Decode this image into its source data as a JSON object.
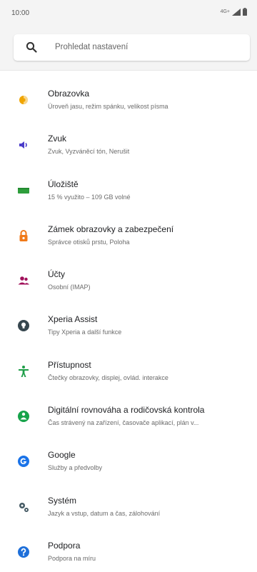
{
  "status_bar": {
    "time": "10:00",
    "network": "4G+"
  },
  "search": {
    "placeholder": "Prohledat nastavení"
  },
  "settings": [
    {
      "title": "Obrazovka",
      "subtitle": "Úroveň jasu, režim spánku, velikost písma",
      "icon": "display-brightness-icon",
      "color": "#F0A500"
    },
    {
      "title": "Zvuk",
      "subtitle": "Zvuk, Vyzváněcí tón, Nerušit",
      "icon": "speaker-icon",
      "color": "#4A3CC9"
    },
    {
      "title": "Úložiště",
      "subtitle": "15 % využito – 109 GB volné",
      "icon": "storage-icon",
      "color": "#2E9E3C"
    },
    {
      "title": "Zámek obrazovky a zabezpečení",
      "subtitle": "Správce otisků prstu, Poloha",
      "icon": "lock-icon",
      "color": "#F07A1A"
    },
    {
      "title": "Účty",
      "subtitle": "Osobní (IMAP)",
      "icon": "accounts-icon",
      "color": "#A0105A"
    },
    {
      "title": "Xperia Assist",
      "subtitle": "Tipy Xperia a další funkce",
      "icon": "lightbulb-icon",
      "color": "#37474F"
    },
    {
      "title": "Přístupnost",
      "subtitle": "Čtečky obrazovky, displej, ovlád. interakce",
      "icon": "accessibility-icon",
      "color": "#1E9E48"
    },
    {
      "title": "Digitální rovnováha a rodičovská kontrola",
      "subtitle": "Čas strávený na zařízení, časovače aplikací, plán v...",
      "icon": "digital-wellbeing-icon",
      "color": "#16A34A"
    },
    {
      "title": "Google",
      "subtitle": "Služby a předvolby",
      "icon": "google-icon",
      "color": "#1A73E8"
    },
    {
      "title": "Systém",
      "subtitle": "Jazyk a vstup, datum a čas, zálohování",
      "icon": "gears-icon",
      "color": "#455A64"
    },
    {
      "title": "Podpora",
      "subtitle": "Podpora na míru",
      "icon": "help-icon",
      "color": "#1E6FD9"
    }
  ]
}
